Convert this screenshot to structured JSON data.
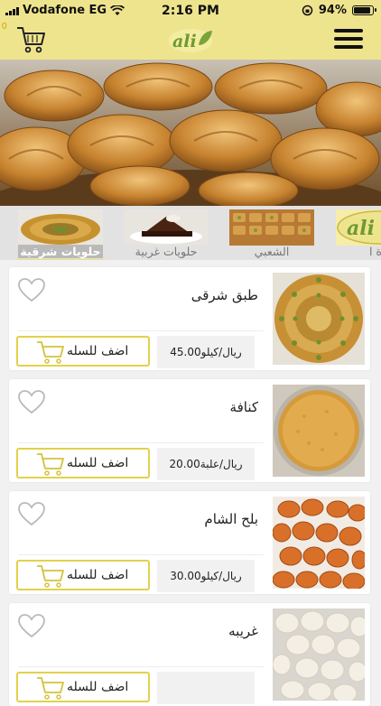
{
  "status_bar": {
    "carrier": "Vodafone EG",
    "time": "2:16 PM",
    "battery": "94%",
    "battery_level": 0.94
  },
  "header": {
    "cart_count": "0",
    "logo_text": "ali"
  },
  "categories": [
    {
      "label": "حلويات شرقية",
      "active": true
    },
    {
      "label": "حلويات غربية",
      "active": false
    },
    {
      "label": "الشعبي",
      "active": false
    },
    {
      "label": "رة ا",
      "active": false,
      "thumb_text": "ali"
    }
  ],
  "products": [
    {
      "name": "طبق شرقى",
      "price": "45.00ريال/كيلو",
      "add_label": "اضف للسله"
    },
    {
      "name": "كنافة",
      "price": "20.00ريال/علبة",
      "add_label": "اضف للسله"
    },
    {
      "name": "بلح الشام",
      "price": "30.00ريال/كيلو",
      "add_label": "اضف للسله"
    },
    {
      "name": "غريبه",
      "price": "",
      "add_label": "اضف للسله"
    }
  ],
  "colors": {
    "header_bg": "#efe48e",
    "accent": "#e3d14a",
    "logo_green": "#7aa43a"
  }
}
